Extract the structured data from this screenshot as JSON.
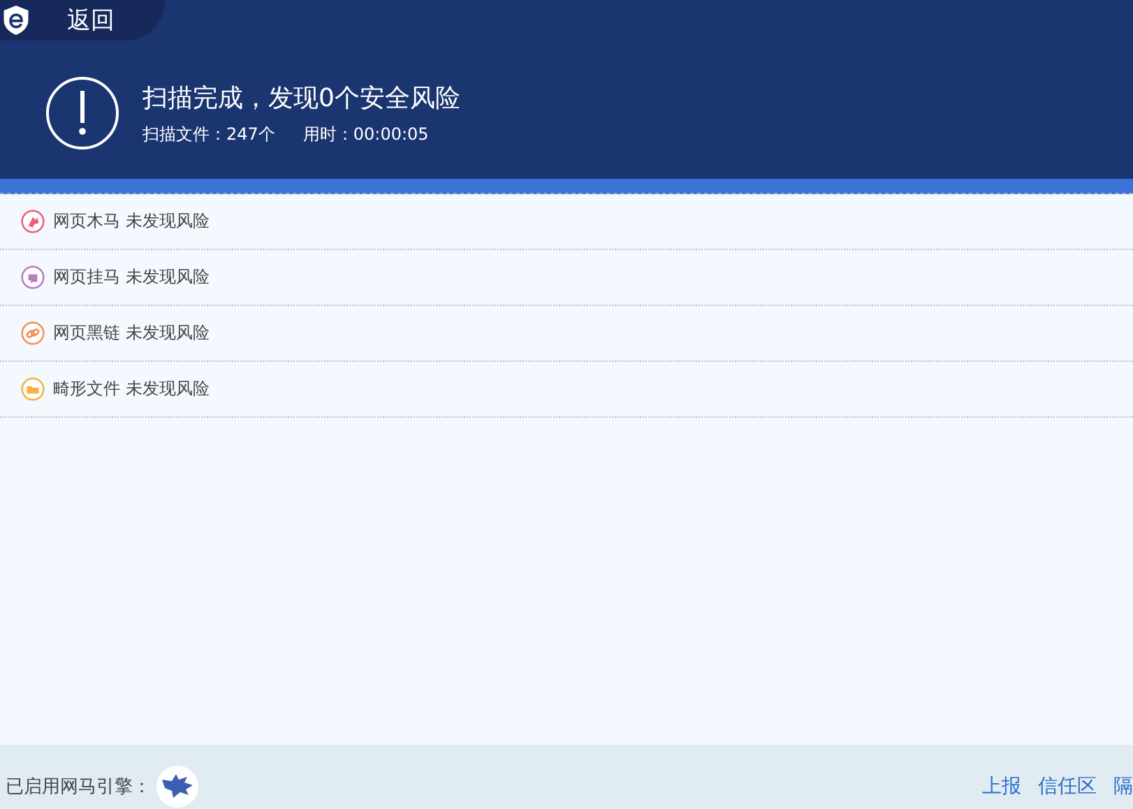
{
  "back_button": {
    "label": "返回"
  },
  "summary": {
    "title": "扫描完成，发现0个安全风险",
    "files": "扫描文件：247个",
    "time": "用时：00:00:05"
  },
  "results": [
    {
      "name": "网页木马",
      "status": "未发现风险",
      "color": "#e8607a",
      "kind": "trojan"
    },
    {
      "name": "网页挂马",
      "status": "未发现风险",
      "color": "#b77dc0",
      "kind": "hanging"
    },
    {
      "name": "网页黑链",
      "status": "未发现风险",
      "color": "#f0915a",
      "kind": "link"
    },
    {
      "name": "畸形文件",
      "status": "未发现风险",
      "color": "#f5b340",
      "kind": "file"
    }
  ],
  "footer": {
    "engine_label": "已启用网马引擎：",
    "links": [
      "上报",
      "信任区",
      "隔"
    ]
  }
}
